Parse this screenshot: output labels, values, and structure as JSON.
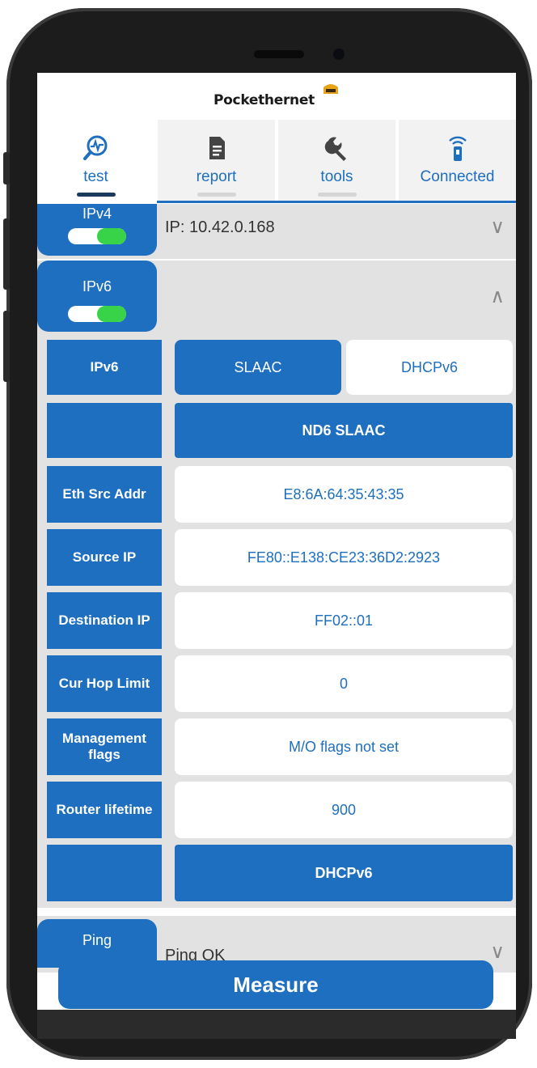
{
  "app": {
    "logo_text": "Pockethernet"
  },
  "tabs": [
    {
      "label": "test",
      "icon": "wave-search-icon",
      "active": true
    },
    {
      "label": "report",
      "icon": "document-icon",
      "active": false
    },
    {
      "label": "tools",
      "icon": "wrench-icon",
      "active": false
    },
    {
      "label": "Connected",
      "icon": "device-signal-icon",
      "active": false
    }
  ],
  "sections": {
    "ipv4": {
      "tab_label": "IPv4",
      "toggle_on": true,
      "value": "IP: 10.42.0.168",
      "expanded": false
    },
    "ipv6": {
      "tab_label": "IPv6",
      "toggle_on": true,
      "value": "",
      "expanded": true
    },
    "ping": {
      "tab_label": "Ping",
      "value": "Ping OK",
      "expanded": false
    }
  },
  "ipv6_details": {
    "mode_label": "IPv6",
    "modes": [
      "SLAAC",
      "DHCPv6"
    ],
    "selected_mode": "SLAAC",
    "nd6_header": "ND6 SLAAC",
    "rows": [
      {
        "label": "Eth Src Addr",
        "value": "E8:6A:64:35:43:35"
      },
      {
        "label": "Source IP",
        "value": "FE80::E138:CE23:36D2:2923"
      },
      {
        "label": "Destination IP",
        "value": "FF02::01"
      },
      {
        "label": "Cur Hop Limit",
        "value": "0"
      },
      {
        "label": "Management flags",
        "value": "M/O flags not set"
      },
      {
        "label": "Router lifetime",
        "value": "900"
      }
    ],
    "dhcp_header": "DHCPv6"
  },
  "actions": {
    "measure_label": "Measure"
  },
  "colors": {
    "accent": "#1e6fbf",
    "toggle_on": "#39d34a",
    "panel": "#e2e2e2"
  }
}
